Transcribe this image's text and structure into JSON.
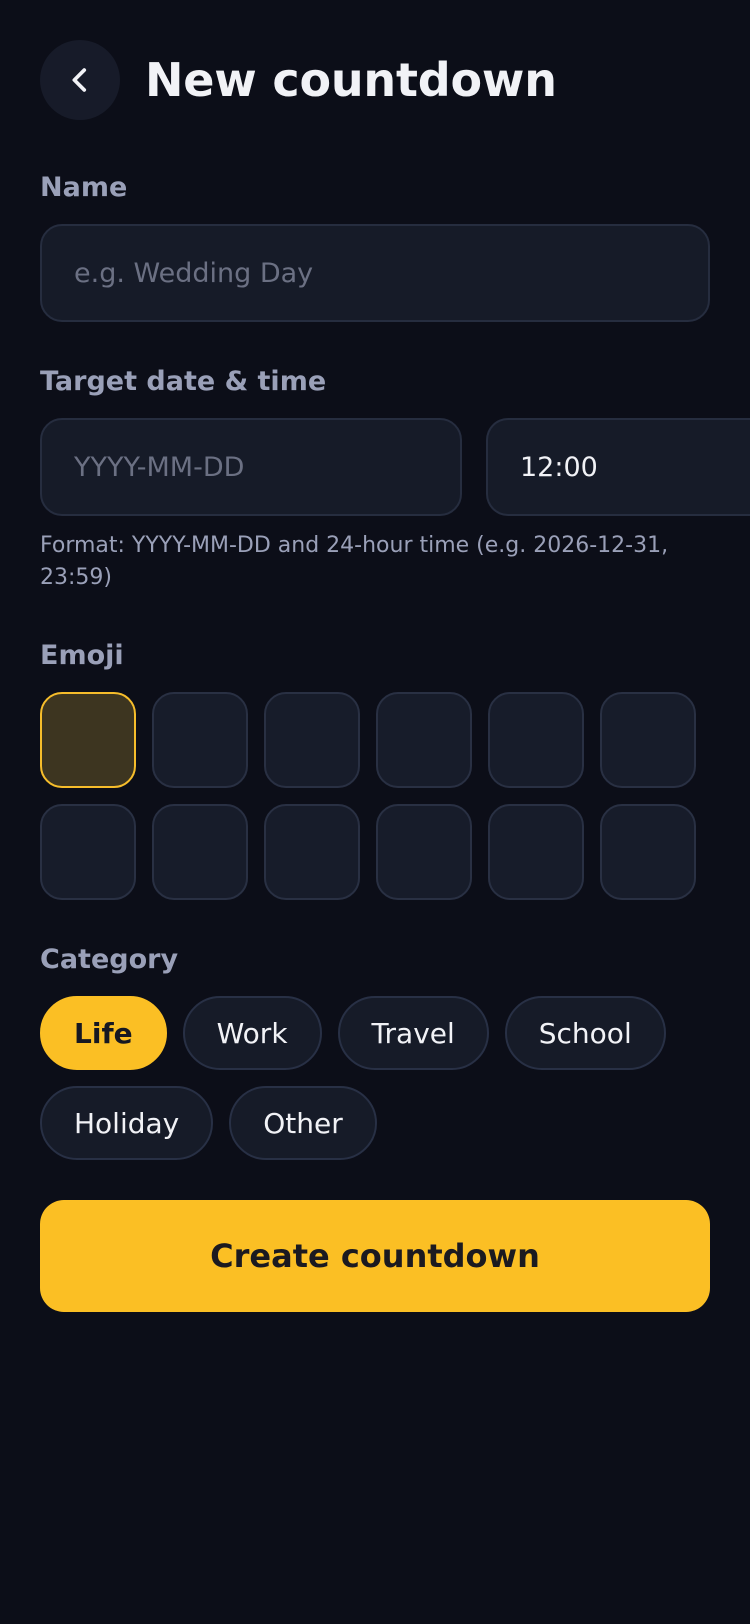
{
  "header": {
    "back_icon": "chevron-left-icon",
    "title": "New countdown"
  },
  "name_section": {
    "label": "Name",
    "placeholder": "e.g. Wedding Day",
    "value": ""
  },
  "date_section": {
    "label": "Target date & time",
    "date_placeholder": "YYYY-MM-DD",
    "date_value": "",
    "time_value": "12:00",
    "hint": "Format: YYYY-MM-DD and 24-hour time (e.g. 2026-12-31, 23:59)"
  },
  "emoji_section": {
    "label": "Emoji",
    "selected_index": 0,
    "tiles": [
      "",
      "",
      "",
      "",
      "",
      "",
      "",
      "",
      "",
      "",
      "",
      ""
    ]
  },
  "category_section": {
    "label": "Category",
    "selected": "Life",
    "chips": [
      "Life",
      "Work",
      "Travel",
      "School",
      "Holiday",
      "Other"
    ]
  },
  "actions": {
    "create_label": "Create countdown"
  },
  "colors": {
    "background": "#0c0e18",
    "surface": "#161b28",
    "accent": "#fbbf24",
    "selected_emoji_bg": "#3d3520",
    "label_text": "#9aa0b8"
  }
}
